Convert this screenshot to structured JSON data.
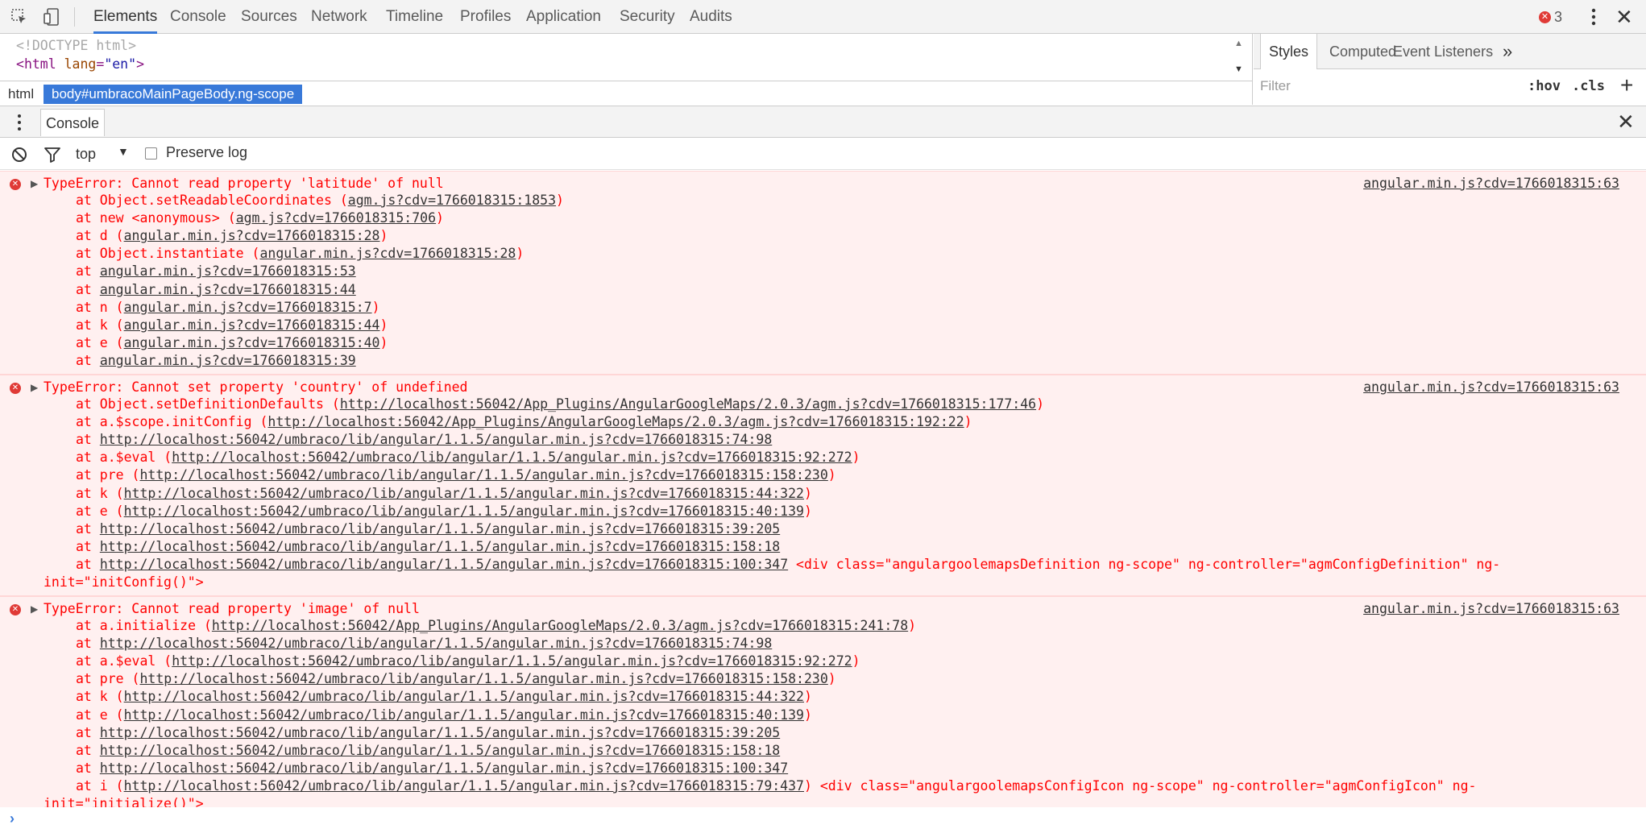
{
  "toolbar": {
    "tabs": [
      "Elements",
      "Console",
      "Sources",
      "Network",
      "Timeline",
      "Profiles",
      "Application",
      "Security",
      "Audits"
    ],
    "active_tab": "Elements",
    "error_count": "3",
    "error_badge_color": "#e03a36",
    "accent_color": "#3879d9"
  },
  "elements": {
    "doctype": "<!DOCTYPE html>",
    "html_open_tag": "html",
    "html_attr_name": "lang",
    "html_attr_value": "\"en\"",
    "breadcrumbs": [
      "html",
      "body#umbracoMainPageBody.ng-scope"
    ]
  },
  "styles": {
    "tabs": [
      "Styles",
      "Computed",
      "Event Listeners"
    ],
    "more": "»",
    "filter_placeholder": "Filter",
    "hov": ":hov",
    "cls": ".cls",
    "add": "+"
  },
  "drawer": {
    "tab": "Console"
  },
  "console_toolbar": {
    "context": "top",
    "preserve_log": "Preserve log",
    "preserve_checked": false
  },
  "messages": [
    {
      "head": "TypeError: Cannot read property 'latitude' of null",
      "source": "angular.min.js?cdv=1766018315:63",
      "stack": [
        {
          "pre": "at Object.setReadableCoordinates (",
          "link": "agm.js?cdv=1766018315:1853",
          "post": ")"
        },
        {
          "pre": "at new <anonymous> (",
          "link": "agm.js?cdv=1766018315:706",
          "post": ")"
        },
        {
          "pre": "at d (",
          "link": "angular.min.js?cdv=1766018315:28",
          "post": ")"
        },
        {
          "pre": "at Object.instantiate (",
          "link": "angular.min.js?cdv=1766018315:28",
          "post": ")"
        },
        {
          "pre": "at ",
          "link": "angular.min.js?cdv=1766018315:53",
          "post": ""
        },
        {
          "pre": "at ",
          "link": "angular.min.js?cdv=1766018315:44",
          "post": ""
        },
        {
          "pre": "at n (",
          "link": "angular.min.js?cdv=1766018315:7",
          "post": ")"
        },
        {
          "pre": "at k (",
          "link": "angular.min.js?cdv=1766018315:44",
          "post": ")"
        },
        {
          "pre": "at e (",
          "link": "angular.min.js?cdv=1766018315:40",
          "post": ")"
        },
        {
          "pre": "at ",
          "link": "angular.min.js?cdv=1766018315:39",
          "post": ""
        }
      ],
      "continuation": ""
    },
    {
      "head": "TypeError: Cannot set property 'country' of undefined",
      "source": "angular.min.js?cdv=1766018315:63",
      "stack": [
        {
          "pre": "at Object.setDefinitionDefaults (",
          "link": "http://localhost:56042/App_Plugins/AngularGoogleMaps/2.0.3/agm.js?cdv=1766018315:177:46",
          "post": ")"
        },
        {
          "pre": "at a.$scope.initConfig (",
          "link": "http://localhost:56042/App_Plugins/AngularGoogleMaps/2.0.3/agm.js?cdv=1766018315:192:22",
          "post": ")"
        },
        {
          "pre": "at ",
          "link": "http://localhost:56042/umbraco/lib/angular/1.1.5/angular.min.js?cdv=1766018315:74:98",
          "post": ""
        },
        {
          "pre": "at a.$eval (",
          "link": "http://localhost:56042/umbraco/lib/angular/1.1.5/angular.min.js?cdv=1766018315:92:272",
          "post": ")"
        },
        {
          "pre": "at pre (",
          "link": "http://localhost:56042/umbraco/lib/angular/1.1.5/angular.min.js?cdv=1766018315:158:230",
          "post": ")"
        },
        {
          "pre": "at k (",
          "link": "http://localhost:56042/umbraco/lib/angular/1.1.5/angular.min.js?cdv=1766018315:44:322",
          "post": ")"
        },
        {
          "pre": "at e (",
          "link": "http://localhost:56042/umbraco/lib/angular/1.1.5/angular.min.js?cdv=1766018315:40:139",
          "post": ")"
        },
        {
          "pre": "at ",
          "link": "http://localhost:56042/umbraco/lib/angular/1.1.5/angular.min.js?cdv=1766018315:39:205",
          "post": ""
        },
        {
          "pre": "at ",
          "link": "http://localhost:56042/umbraco/lib/angular/1.1.5/angular.min.js?cdv=1766018315:158:18",
          "post": ""
        },
        {
          "pre": "at ",
          "link": "http://localhost:56042/umbraco/lib/angular/1.1.5/angular.min.js?cdv=1766018315:100:347",
          "post": " <div class=\"angulargoolemapsDefinition ng-scope\" ng-controller=\"agmConfigDefinition\" ng-"
        }
      ],
      "continuation": "init=\"initConfig()\">"
    },
    {
      "head": "TypeError: Cannot read property 'image' of null",
      "source": "angular.min.js?cdv=1766018315:63",
      "stack": [
        {
          "pre": "at a.initialize (",
          "link": "http://localhost:56042/App_Plugins/AngularGoogleMaps/2.0.3/agm.js?cdv=1766018315:241:78",
          "post": ")"
        },
        {
          "pre": "at ",
          "link": "http://localhost:56042/umbraco/lib/angular/1.1.5/angular.min.js?cdv=1766018315:74:98",
          "post": ""
        },
        {
          "pre": "at a.$eval (",
          "link": "http://localhost:56042/umbraco/lib/angular/1.1.5/angular.min.js?cdv=1766018315:92:272",
          "post": ")"
        },
        {
          "pre": "at pre (",
          "link": "http://localhost:56042/umbraco/lib/angular/1.1.5/angular.min.js?cdv=1766018315:158:230",
          "post": ")"
        },
        {
          "pre": "at k (",
          "link": "http://localhost:56042/umbraco/lib/angular/1.1.5/angular.min.js?cdv=1766018315:44:322",
          "post": ")"
        },
        {
          "pre": "at e (",
          "link": "http://localhost:56042/umbraco/lib/angular/1.1.5/angular.min.js?cdv=1766018315:40:139",
          "post": ")"
        },
        {
          "pre": "at ",
          "link": "http://localhost:56042/umbraco/lib/angular/1.1.5/angular.min.js?cdv=1766018315:39:205",
          "post": ""
        },
        {
          "pre": "at ",
          "link": "http://localhost:56042/umbraco/lib/angular/1.1.5/angular.min.js?cdv=1766018315:158:18",
          "post": ""
        },
        {
          "pre": "at ",
          "link": "http://localhost:56042/umbraco/lib/angular/1.1.5/angular.min.js?cdv=1766018315:100:347",
          "post": ""
        },
        {
          "pre": "at i (",
          "link": "http://localhost:56042/umbraco/lib/angular/1.1.5/angular.min.js?cdv=1766018315:79:437",
          "post": ") <div class=\"angulargoolemapsConfigIcon ng-scope\" ng-controller=\"agmConfigIcon\" ng-"
        }
      ],
      "continuation": "init=\"initialize()\">"
    }
  ],
  "prompt": {
    "caret": "›"
  }
}
